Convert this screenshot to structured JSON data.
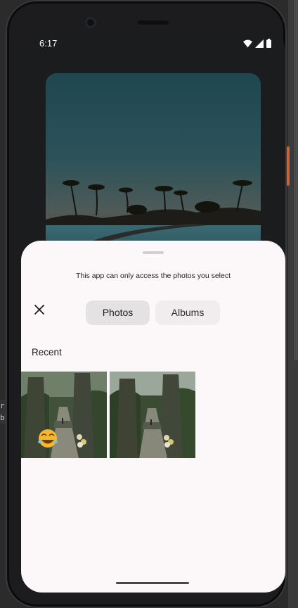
{
  "status_bar": {
    "time": "6:17",
    "icons": [
      "wifi-icon",
      "signal-icon",
      "battery-icon"
    ]
  },
  "side_text": [
    "r",
    "b"
  ],
  "picker": {
    "notice": "This app can only access the photos you select",
    "close_icon": "close-icon",
    "tabs": [
      {
        "label": "Photos",
        "selected": true
      },
      {
        "label": "Albums",
        "selected": false
      }
    ],
    "section_title": "Recent",
    "thumbnails": [
      {
        "description": "gate-path-photo",
        "overlay_emoji": "🤣"
      },
      {
        "description": "gate-path-photo",
        "overlay_emoji": "🎠"
      }
    ]
  },
  "colors": {
    "sheet_background": "#fcf8f9",
    "selected_tab": "#e4e2e3",
    "unselected_tab": "#f1edee",
    "phone_frame": "#1c1c1e"
  }
}
